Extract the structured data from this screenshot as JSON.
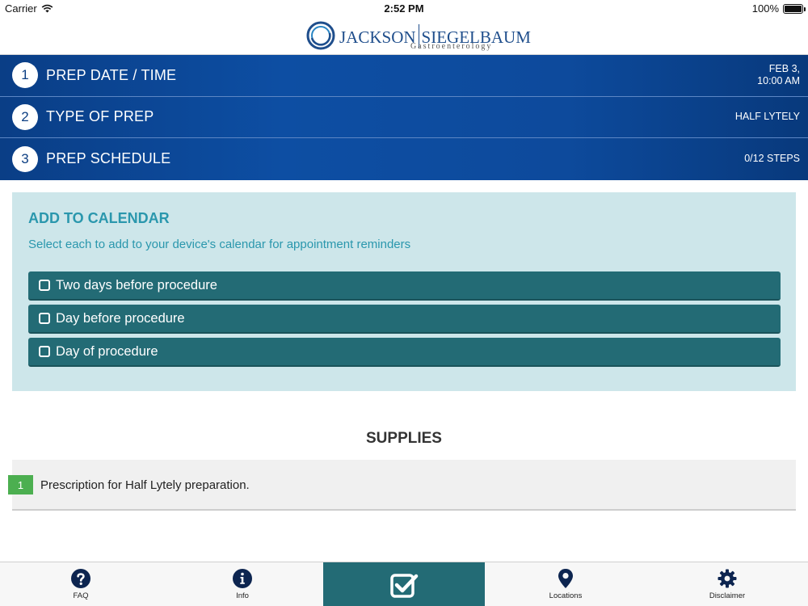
{
  "status_bar": {
    "carrier": "Carrier",
    "time": "2:52 PM",
    "battery": "100%"
  },
  "header": {
    "logo_left": "JACKSON",
    "logo_right": "SIEGELBAUM",
    "logo_sub": "Gastroenterology"
  },
  "steps": [
    {
      "num": "1",
      "title": "PREP DATE / TIME",
      "value_line1": "FEB 3,",
      "value_line2": "10:00 AM"
    },
    {
      "num": "2",
      "title": "TYPE OF PREP",
      "value_line1": "HALF LYTELY",
      "value_line2": ""
    },
    {
      "num": "3",
      "title": "PREP SCHEDULE",
      "value_line1": "0/12 STEPS",
      "value_line2": ""
    }
  ],
  "calendar": {
    "heading": "ADD TO CALENDAR",
    "description": "Select each to add to your device's calendar for appointment reminders",
    "options": [
      {
        "label": "Two days before procedure",
        "checked": false
      },
      {
        "label": "Day before procedure",
        "checked": false
      },
      {
        "label": "Day of procedure",
        "checked": false
      }
    ]
  },
  "supplies": {
    "title": "SUPPLIES",
    "items": [
      {
        "num": "1",
        "text": "Prescription for Half Lytely preparation."
      }
    ]
  },
  "tabbar": {
    "tabs": [
      {
        "label": "FAQ",
        "icon": "question-icon"
      },
      {
        "label": "Info",
        "icon": "info-icon"
      },
      {
        "label": "",
        "icon": "checklist-icon",
        "active": true
      },
      {
        "label": "Locations",
        "icon": "location-pin-icon"
      },
      {
        "label": "Disclaimer",
        "icon": "gear-icon"
      }
    ]
  },
  "colors": {
    "step_bar": "#0d4ea3",
    "calendar_panel": "#cde6ea",
    "accent_teal": "#236b75",
    "heading_teal": "#2a97ad",
    "supply_badge": "#4caf50"
  }
}
